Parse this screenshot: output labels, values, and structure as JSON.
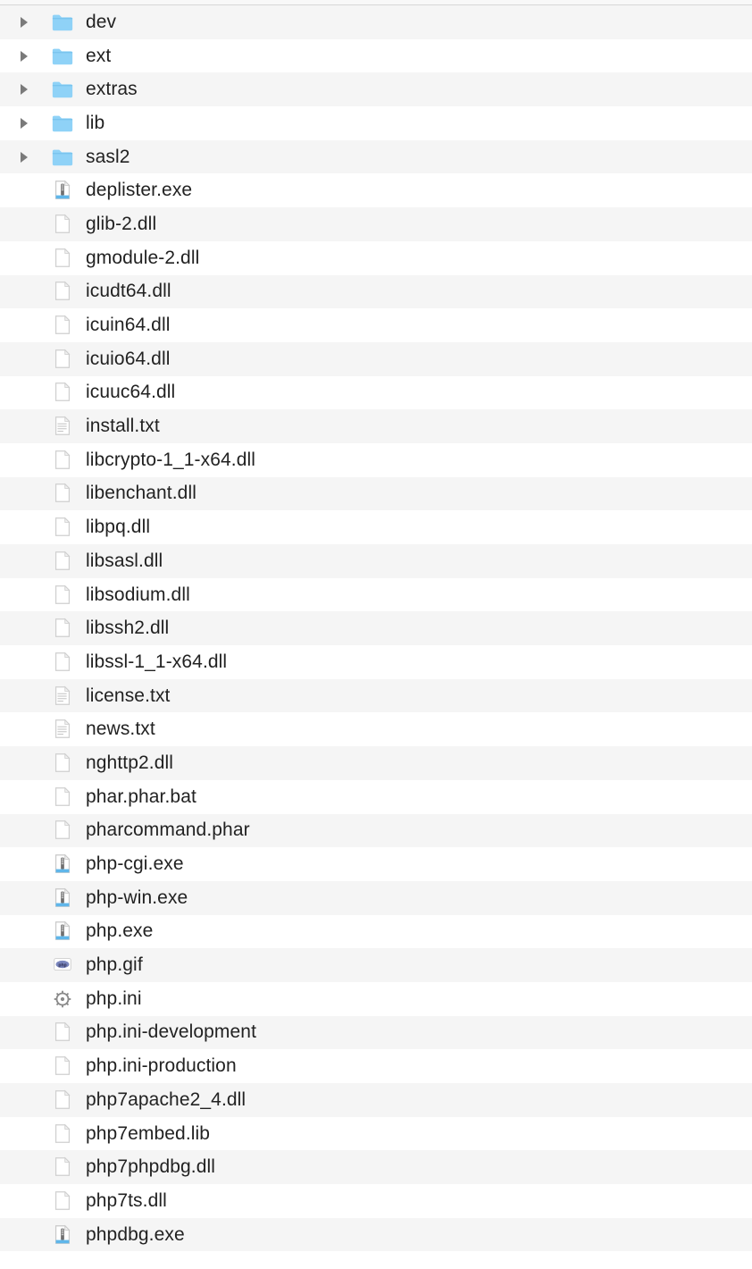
{
  "entries": [
    {
      "name": "dev",
      "type": "folder",
      "expandable": true
    },
    {
      "name": "ext",
      "type": "folder",
      "expandable": true
    },
    {
      "name": "extras",
      "type": "folder",
      "expandable": true
    },
    {
      "name": "lib",
      "type": "folder",
      "expandable": true
    },
    {
      "name": "sasl2",
      "type": "folder",
      "expandable": true
    },
    {
      "name": "deplister.exe",
      "type": "exe",
      "expandable": false
    },
    {
      "name": "glib-2.dll",
      "type": "file",
      "expandable": false
    },
    {
      "name": "gmodule-2.dll",
      "type": "file",
      "expandable": false
    },
    {
      "name": "icudt64.dll",
      "type": "file",
      "expandable": false
    },
    {
      "name": "icuin64.dll",
      "type": "file",
      "expandable": false
    },
    {
      "name": "icuio64.dll",
      "type": "file",
      "expandable": false
    },
    {
      "name": "icuuc64.dll",
      "type": "file",
      "expandable": false
    },
    {
      "name": "install.txt",
      "type": "txt",
      "expandable": false
    },
    {
      "name": "libcrypto-1_1-x64.dll",
      "type": "file",
      "expandable": false
    },
    {
      "name": "libenchant.dll",
      "type": "file",
      "expandable": false
    },
    {
      "name": "libpq.dll",
      "type": "file",
      "expandable": false
    },
    {
      "name": "libsasl.dll",
      "type": "file",
      "expandable": false
    },
    {
      "name": "libsodium.dll",
      "type": "file",
      "expandable": false
    },
    {
      "name": "libssh2.dll",
      "type": "file",
      "expandable": false
    },
    {
      "name": "libssl-1_1-x64.dll",
      "type": "file",
      "expandable": false
    },
    {
      "name": "license.txt",
      "type": "txt",
      "expandable": false
    },
    {
      "name": "news.txt",
      "type": "txt",
      "expandable": false
    },
    {
      "name": "nghttp2.dll",
      "type": "file",
      "expandable": false
    },
    {
      "name": "phar.phar.bat",
      "type": "file",
      "expandable": false
    },
    {
      "name": "pharcommand.phar",
      "type": "file",
      "expandable": false
    },
    {
      "name": "php-cgi.exe",
      "type": "exe",
      "expandable": false
    },
    {
      "name": "php-win.exe",
      "type": "exe",
      "expandable": false
    },
    {
      "name": "php.exe",
      "type": "exe",
      "expandable": false
    },
    {
      "name": "php.gif",
      "type": "gif",
      "expandable": false
    },
    {
      "name": "php.ini",
      "type": "ini",
      "expandable": false
    },
    {
      "name": "php.ini-development",
      "type": "file",
      "expandable": false
    },
    {
      "name": "php.ini-production",
      "type": "file",
      "expandable": false
    },
    {
      "name": "php7apache2_4.dll",
      "type": "file",
      "expandable": false
    },
    {
      "name": "php7embed.lib",
      "type": "file",
      "expandable": false
    },
    {
      "name": "php7phpdbg.dll",
      "type": "file",
      "expandable": false
    },
    {
      "name": "php7ts.dll",
      "type": "file",
      "expandable": false
    },
    {
      "name": "phpdbg.exe",
      "type": "exe",
      "expandable": false
    }
  ]
}
